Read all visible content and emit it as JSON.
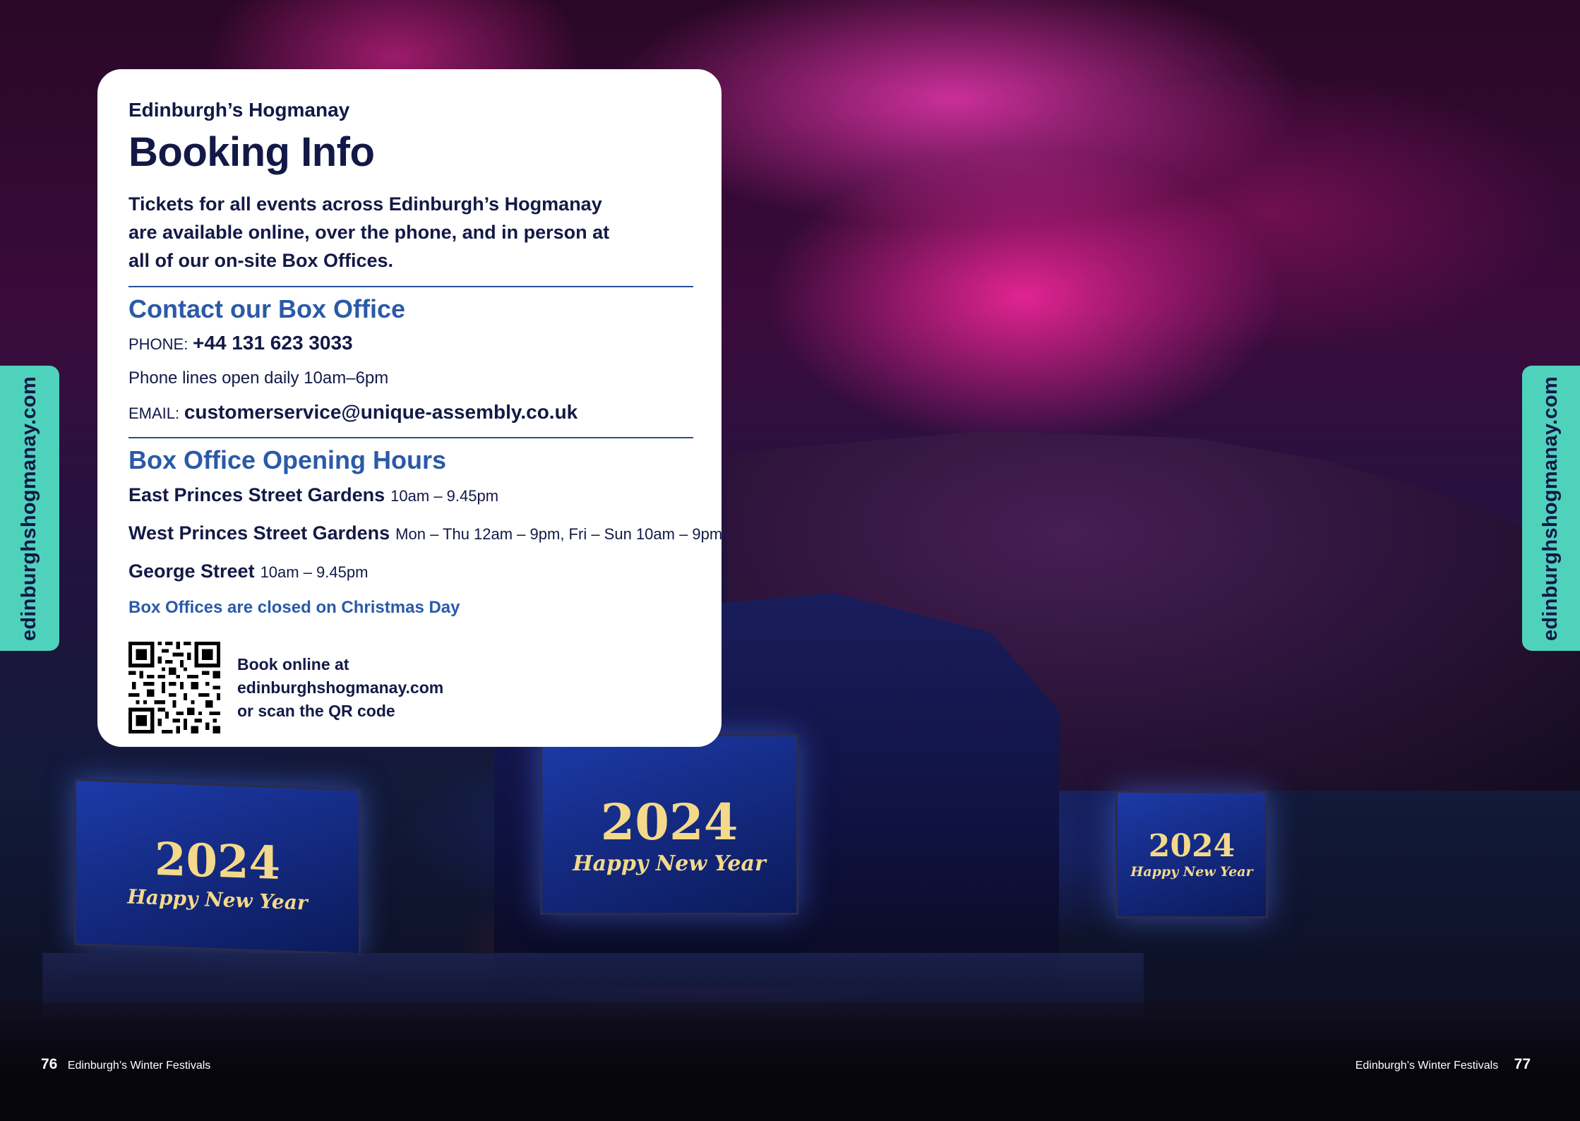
{
  "card": {
    "eyebrow": "Edinburgh’s Hogmanay",
    "title": "Booking Info",
    "intro": "Tickets for all events across Edinburgh’s Hogmanay are available online, over the phone, and in person at all of our on-site Box Offices.",
    "contact": {
      "heading": "Contact our Box Office",
      "phone_label": "PHONE:",
      "phone": "+44 131 623 3033",
      "phone_hours": "Phone lines open daily 10am–6pm",
      "email_label": "EMAIL:",
      "email": "customerservice@unique-assembly.co.uk"
    },
    "hours": {
      "heading": "Box Office Opening Hours",
      "venues": [
        {
          "name": "East Princes Street Gardens",
          "times": "10am – 9.45pm"
        },
        {
          "name": "West Princes Street Gardens",
          "times": "Mon – Thu 12am – 9pm, Fri – Sun 10am – 9pm"
        },
        {
          "name": "George Street",
          "times": "10am – 9.45pm"
        }
      ],
      "note": "Box Offices are closed on Christmas Day"
    },
    "booking": {
      "line1": "Book online at",
      "line2": "edinburghshogmanay.com",
      "line3": "or scan the QR code"
    }
  },
  "side_tab": {
    "text": "edinburghshogmanay.com"
  },
  "footer": {
    "left_page": "76",
    "left_text": "Edinburgh’s Winter Festivals",
    "right_text": "Edinburgh’s Winter Festivals",
    "right_page": "77"
  },
  "photo": {
    "screen_year": "2024",
    "screen_caption": "Happy New Year"
  },
  "colors": {
    "navy": "#131946",
    "blue_heading": "#2a5aa8",
    "teal_tab": "#4fd2bc",
    "card_bg": "#ffffff"
  },
  "icons": [
    "qr-code-icon"
  ]
}
